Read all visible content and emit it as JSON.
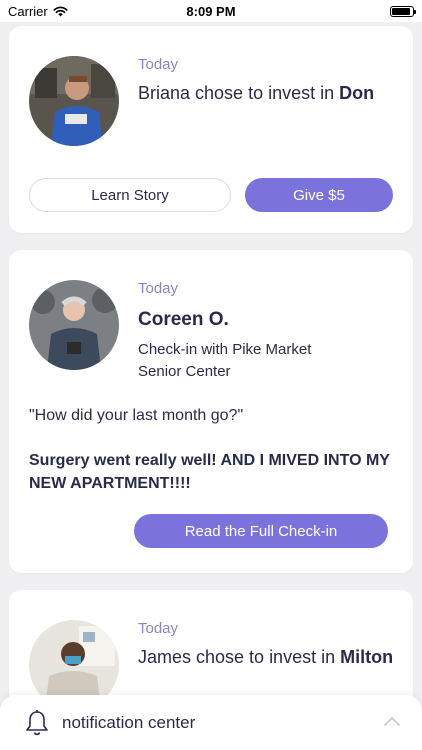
{
  "status_bar": {
    "carrier": "Carrier",
    "time": "8:09 PM"
  },
  "feed": [
    {
      "type": "investment",
      "date": "Today",
      "text_prefix": "Briana chose to invest in ",
      "recipient": "Don",
      "secondary_button": "Learn Story",
      "primary_button": "Give $5"
    },
    {
      "type": "checkin",
      "date": "Today",
      "name": "Coreen O.",
      "subtitle": "Check-in with Pike Market Senior Center",
      "question": "\"How did your last month go?\"",
      "answer": "Surgery went really well!  AND I MIVED INTO MY NEW APARTMENT!!!!",
      "button": "Read the Full Check-in"
    },
    {
      "type": "investment",
      "date": "Today",
      "text_prefix": "James chose to invest in ",
      "recipient": "Milton"
    }
  ],
  "notification_bar": {
    "label": "notification center",
    "icon": "bell-icon",
    "toggle_icon": "chevron-up-icon"
  },
  "colors": {
    "accent": "#7b73dc",
    "date_text": "#8b86bd",
    "primary_text": "#2a2b4a",
    "background": "#f0f0f3"
  }
}
